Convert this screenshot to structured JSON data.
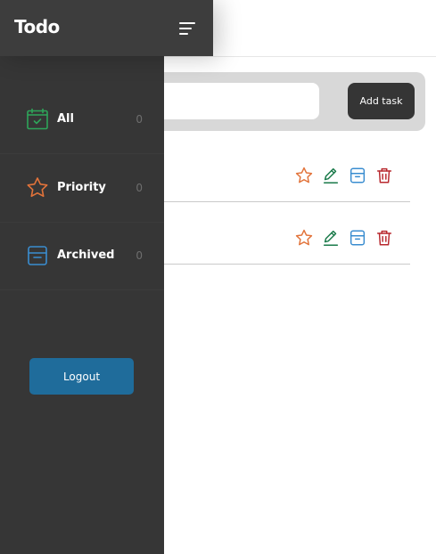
{
  "app": {
    "title": "Todo"
  },
  "sidebar": {
    "items": [
      {
        "label": "All",
        "count": "0",
        "icon": "calendar-check-icon",
        "color": "#2ea55a"
      },
      {
        "label": "Priority",
        "count": "0",
        "icon": "star-icon",
        "color": "#e2733a"
      },
      {
        "label": "Archived",
        "count": "0",
        "icon": "archive-icon",
        "color": "#3a8dd0"
      }
    ],
    "logout_label": "Logout"
  },
  "add_task": {
    "button_label": "Add task",
    "input_value": "",
    "placeholder": ""
  },
  "tasks": [
    {
      "title": ""
    },
    {
      "title": ""
    }
  ],
  "colors": {
    "sidebar_bg": "#363636",
    "header_bg": "#3d3d3d",
    "logout_bg": "#1f6c9b",
    "star": "#e2733a",
    "edit": "#1a7a4a",
    "archive": "#3a8dd0",
    "delete": "#b8282e"
  }
}
